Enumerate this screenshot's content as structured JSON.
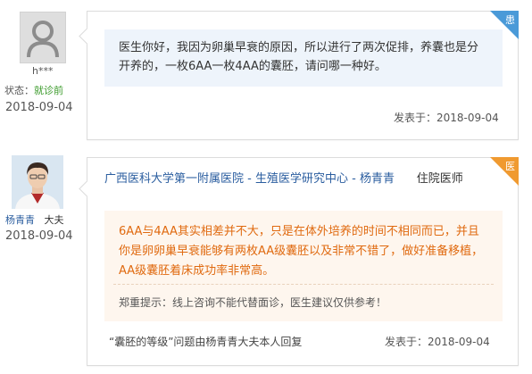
{
  "question": {
    "user_name": "h***",
    "status_label": "状态：",
    "status_value": "就诊前",
    "date": "2018-09-04",
    "badge": "患",
    "text": "医生你好，我因为卵巢早衰的原因，所以进行了两次促排，养囊也是分开养的，一枚6AA一枚4AA的囊胚，请问哪一种好。",
    "posted_label": "发表于：",
    "posted_date": "2018-09-04"
  },
  "answer": {
    "doctor_name": "杨青青",
    "doctor_suffix": "大夫",
    "date": "2018-09-04",
    "badge": "医",
    "hospital": "广西医科大学第一附属医院",
    "separator1": " - ",
    "department": "生殖医学研究中心",
    "separator2": " - ",
    "doctor_link": "杨青青",
    "doctor_title": "住院医师",
    "text": "6AA与4AA其实相差并不大，只是在体外培养的时间不相同而已，并且你是卵卵巢早衰能够有两枚AA级囊胚以及非常不错了，做好准备移植，AA级囊胚着床成功率非常高。",
    "disclaimer": "郑重提示：线上咨询不能代替面诊，医生建议仅供参考！",
    "footer_note": "“囊胚的等级”问题由杨青青大夫本人回复",
    "posted_label": "发表于：",
    "posted_date": "2018-09-04"
  },
  "colors": {
    "patient_badge": "#4a9ad8",
    "doctor_badge": "#f09a30",
    "link": "#2a5d9f",
    "answer_text": "#e06a10",
    "status_value": "#3a9a2a"
  }
}
